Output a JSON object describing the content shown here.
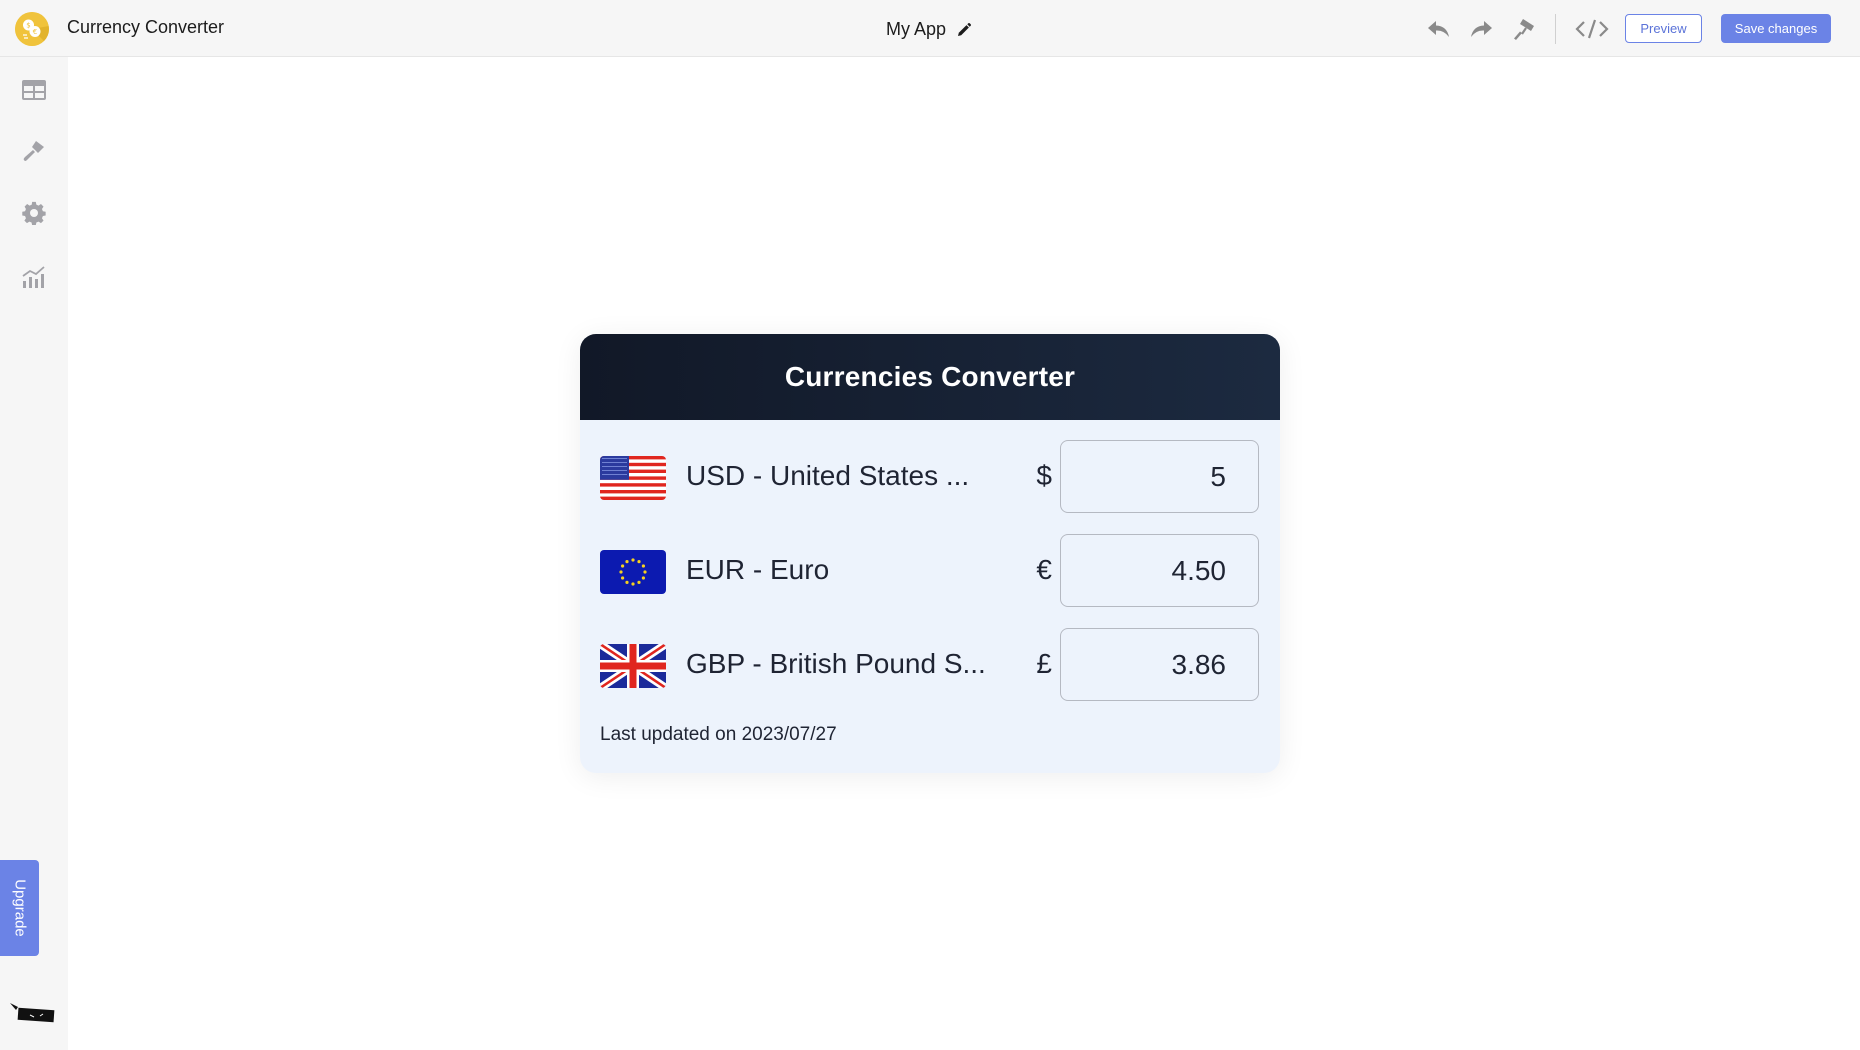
{
  "topbar": {
    "logo_icon": "currency-coins-icon",
    "app_name": "Currency Converter",
    "project_title": "My App",
    "edit_icon": "pencil-icon",
    "tools": [
      {
        "name": "undo-icon"
      },
      {
        "name": "redo-icon"
      },
      {
        "name": "paint-roller-icon"
      },
      {
        "name": "code-icon"
      }
    ],
    "preview_label": "Preview",
    "save_label": "Save changes"
  },
  "sidebar": {
    "items": [
      {
        "name": "table-icon"
      },
      {
        "name": "paintbrush-icon"
      },
      {
        "name": "gear-icon"
      },
      {
        "name": "analytics-icon"
      }
    ],
    "upgrade_label": "Upgrade"
  },
  "widget": {
    "title": "Currencies Converter",
    "rows": [
      {
        "flag": "us-flag-icon",
        "name": "USD - United States ...",
        "symbol": "$",
        "amount": "5"
      },
      {
        "flag": "eu-flag-icon",
        "name": "EUR - Euro",
        "symbol": "€",
        "amount": "4.50"
      },
      {
        "flag": "uk-flag-icon",
        "name": "GBP - British Pound S...",
        "symbol": "£",
        "amount": "3.86"
      }
    ],
    "last_updated": "Last updated on 2023/07/27"
  },
  "colors": {
    "accent": "#6b83e6",
    "header_dark": "#111827",
    "card_bg": "#edf3fc",
    "logo_yellow": "#f0c33c"
  }
}
